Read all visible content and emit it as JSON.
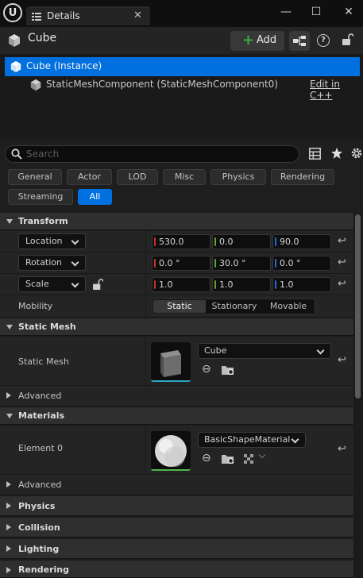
{
  "window": {
    "tab_label": "Details",
    "close_glyph": "✕",
    "minimize_glyph": "—",
    "maximize_glyph": "☐",
    "window_close_glyph": "✕",
    "logo_glyph": "U"
  },
  "header": {
    "actor_name": "Cube",
    "add_label": "Add",
    "add_glyph": "+",
    "help_glyph": "?"
  },
  "tree": {
    "items": [
      {
        "label": "Cube (Instance)"
      },
      {
        "label": "StaticMeshComponent (StaticMeshComponent0)"
      }
    ],
    "edit_cpp": "Edit in C++"
  },
  "search": {
    "placeholder": "Search",
    "value": ""
  },
  "filters": {
    "row1": [
      "General",
      "Actor",
      "LOD",
      "Misc",
      "Physics",
      "Rendering"
    ],
    "row2": [
      "Streaming",
      "All"
    ],
    "active": "All"
  },
  "transform": {
    "title": "Transform",
    "location": {
      "label": "Location",
      "x": "530.0",
      "y": "0.0",
      "z": "90.0"
    },
    "rotation": {
      "label": "Rotation",
      "x": "0.0 °",
      "y": "30.0 °",
      "z": "0.0 °"
    },
    "scale": {
      "label": "Scale",
      "x": "1.0",
      "y": "1.0",
      "z": "1.0"
    },
    "mobility": {
      "label": "Mobility",
      "options": [
        "Static",
        "Stationary",
        "Movable"
      ],
      "selected": "Static"
    }
  },
  "static_mesh": {
    "title": "Static Mesh",
    "label": "Static Mesh",
    "asset": "Cube",
    "advanced": "Advanced"
  },
  "materials": {
    "title": "Materials",
    "label": "Element 0",
    "asset": "BasicShapeMaterial",
    "advanced": "Advanced"
  },
  "categories": [
    "Physics",
    "Collision",
    "Lighting",
    "Rendering"
  ],
  "colors": {
    "accent": "#0070e0",
    "x_axis": "#c8302c",
    "y_axis": "#5aa72c",
    "z_axis": "#2a66d8",
    "add_plus": "#3aae3a"
  },
  "icons": [
    "unreal-logo-icon",
    "details-icon",
    "close-icon",
    "minimize-icon",
    "maximize-icon",
    "cube-icon",
    "add-icon",
    "blueprint-icon",
    "help-icon",
    "lock-icon",
    "search-icon",
    "table-view-icon",
    "star-icon",
    "settings-icon",
    "reset-icon",
    "browse-icon",
    "use-selected-icon",
    "chevron-down-icon",
    "expand-arrow-icon",
    "collapse-arrow-icon"
  ]
}
